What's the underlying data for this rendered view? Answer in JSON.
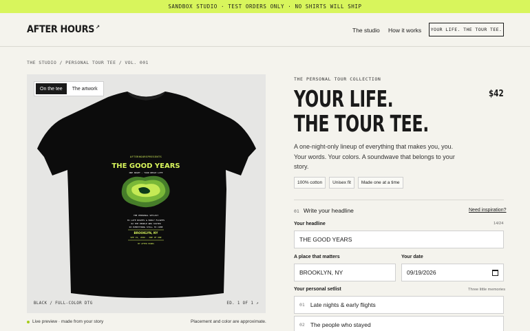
{
  "banner": {
    "text": "SANDBOX STUDIO · TEST ORDERS ONLY · NO SHIRTS WILL SHIP"
  },
  "header": {
    "logo": "AFTER HOURS",
    "logo_mark": "↗",
    "nav": {
      "studio": "The studio",
      "how": "How it works",
      "cta": "YOUR LIFE. THE TOUR TEE."
    }
  },
  "breadcrumb": "THE STUDIO / PERSONAL TOUR TEE / VOL. 001",
  "preview": {
    "toggle": {
      "tee": "On the tee",
      "artwork": "The artwork"
    },
    "shirt_color": "#0c0c0c",
    "accent": "#d8f55c",
    "artwork": {
      "presents": "AFTERHOURSPRESENTS",
      "headline": "THE GOOD YEARS",
      "sub": "ONE NIGHT · YOUR WHOLE LIFE",
      "setlist_title": "THE PERSONAL SETLIST",
      "setlist": [
        "01 LATE NIGHTS & EARLY FLIGHTS",
        "02 THE PEOPLE WHO STAYED",
        "03 EVERYTHING STILL TO COME"
      ],
      "place": "BROOKLYN, NY",
      "date": "SEP 19, 2026 · ONE OF ONE",
      "credit": "BY AFTER HOURS"
    },
    "foot_left": "BLACK / FULL-COLOR DTG",
    "foot_right": "ED. 1 OF 1 ↗",
    "live": "Live preview · made from your story",
    "note": "Placement and color are approximate."
  },
  "product": {
    "eyebrow": "THE PERSONAL TOUR COLLECTION",
    "title_line1": "YOUR LIFE.",
    "title_line2": "THE TOUR TEE.",
    "price": "$42",
    "description": "A one-night-only lineup of everything that makes you, you. Your words. Your colors. A soundwave that belongs to your story.",
    "chips": [
      "100% cotton",
      "Unisex fit",
      "Made one at a time"
    ]
  },
  "form": {
    "step_num": "01",
    "step_label": "Write your headline",
    "inspire": "Need inspiration?",
    "headline_label": "Your headline",
    "headline_count": "14/24",
    "headline_value": "THE GOOD YEARS",
    "place_label": "A place that matters",
    "place_value": "BROOKLYN, NY",
    "date_label": "Your date",
    "date_value": "09/19/2026",
    "setlist_label": "Your personal setlist",
    "setlist_hint": "Three little memories",
    "setlist": [
      {
        "num": "01",
        "value": "Late nights & early flights"
      },
      {
        "num": "02",
        "value": "The people who stayed"
      }
    ]
  }
}
